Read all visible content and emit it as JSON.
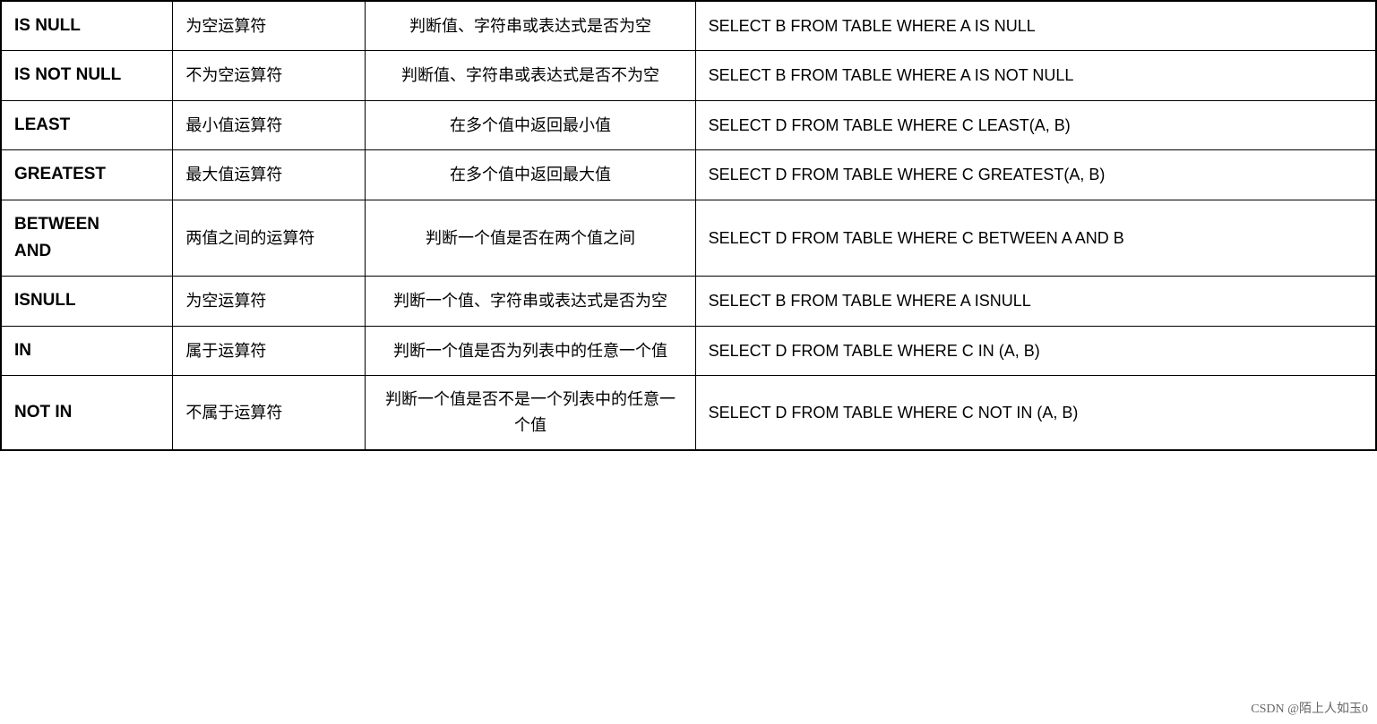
{
  "table": {
    "rows": [
      {
        "operator": "IS NULL",
        "description": "为空运算符",
        "explanation": "判断值、字符串或表达式是否为空",
        "example": "SELECT B FROM TABLE WHERE A IS NULL"
      },
      {
        "operator": "IS NOT NULL",
        "description": "不为空运算符",
        "explanation": "判断值、字符串或表达式是否不为空",
        "example": "SELECT B FROM TABLE WHERE A IS NOT NULL"
      },
      {
        "operator": "LEAST",
        "description": "最小值运算符",
        "explanation": "在多个值中返回最小值",
        "example": "SELECT D FROM TABLE WHERE C LEAST(A, B)"
      },
      {
        "operator": "GREATEST",
        "description": "最大值运算符",
        "explanation": "在多个值中返回最大值",
        "example": "SELECT D FROM TABLE WHERE C GREATEST(A, B)"
      },
      {
        "operator": "BETWEEN\nAND",
        "description": "两值之间的运算符",
        "explanation": "判断一个值是否在两个值之间",
        "example": "SELECT D FROM TABLE WHERE C BETWEEN A AND B"
      },
      {
        "operator": "ISNULL",
        "description": "为空运算符",
        "explanation": "判断一个值、字符串或表达式是否为空",
        "example": "SELECT B FROM TABLE WHERE A ISNULL"
      },
      {
        "operator": "IN",
        "description": "属于运算符",
        "explanation": "判断一个值是否为列表中的任意一个值",
        "example": "SELECT D FROM TABLE WHERE C IN (A, B)"
      },
      {
        "operator": "NOT IN",
        "description": "不属于运算符",
        "explanation": "判断一个值是否不是一个列表中的任意一个值",
        "example": "SELECT D FROM TABLE WHERE C NOT IN (A, B)"
      }
    ],
    "watermark": "CSDN @陌上人如玉0"
  }
}
